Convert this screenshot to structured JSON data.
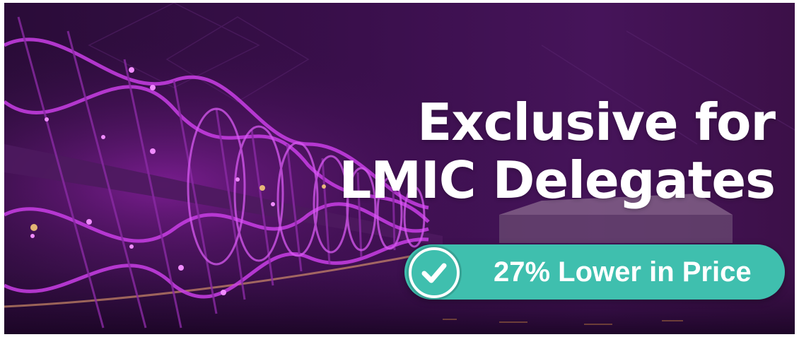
{
  "banner": {
    "headline_line1": "Exclusive for",
    "headline_line2": "LMIC Delegates",
    "badge_text": "27% Lower in Price",
    "badge_icon": "check-circle-icon",
    "background": "helix-bridge-night-photo"
  },
  "colors": {
    "background_purple": "#3a0f4c",
    "accent_magenta": "#d63cf0",
    "badge_teal": "#3fbfae",
    "text_white": "#ffffff"
  }
}
